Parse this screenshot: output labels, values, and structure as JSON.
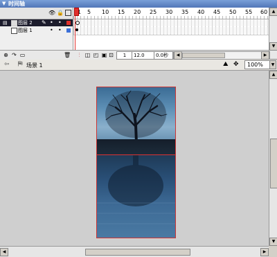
{
  "window": {
    "title": "时间轴"
  },
  "timeline": {
    "layers": [
      {
        "name": "图层 2",
        "selected": true,
        "color": "#e0302c"
      },
      {
        "name": "图层 1",
        "selected": false,
        "color": "#3b6fd8"
      }
    ],
    "frame_numbers": [
      "1",
      "5",
      "10",
      "15",
      "20",
      "25",
      "30",
      "35",
      "40",
      "45",
      "50",
      "55",
      "60"
    ],
    "current_frame": "1",
    "fps": "12.0 fps",
    "elapsed": "0.0秒"
  },
  "editbar": {
    "scene": "场景 1",
    "zoom": "100%"
  },
  "colors": {
    "stage_border": "#cc3333",
    "playhead": "#e0302c"
  }
}
